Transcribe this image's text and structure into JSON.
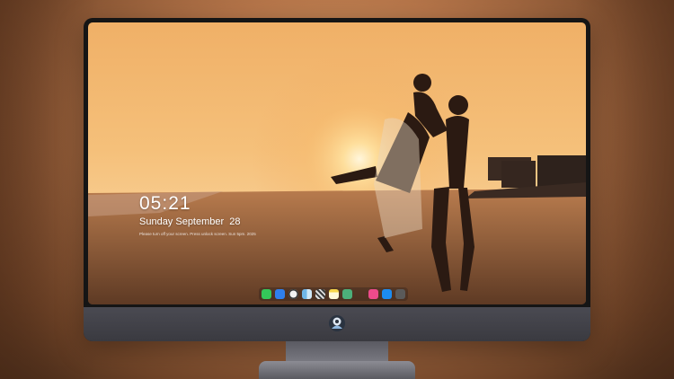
{
  "lock_screen": {
    "time": "05:21",
    "date": "Sunday September  28",
    "note": "Please turn off your screen. Press  unlock screen.  Sun 5pm. 2025"
  },
  "dock": {
    "items": [
      {
        "icon": "messages-icon",
        "color": "#34c759"
      },
      {
        "icon": "mail-icon",
        "color": "#2f80ed"
      },
      {
        "icon": "clock-icon",
        "color": "#f2f2f2"
      },
      {
        "icon": "finder-icon",
        "color": "#6fb7e8"
      },
      {
        "icon": "clapperboard-icon",
        "color": "#3a3a3a"
      },
      {
        "icon": "notes-icon",
        "color": "#f7d54a"
      },
      {
        "icon": "photos-icon",
        "color": "#4caf7a"
      },
      {
        "icon": "music-icon",
        "color": "#ee4b8b"
      },
      {
        "icon": "app-store-icon",
        "color": "#1c8cf0"
      },
      {
        "icon": "camera-icon",
        "color": "#5a5a5a"
      }
    ]
  }
}
